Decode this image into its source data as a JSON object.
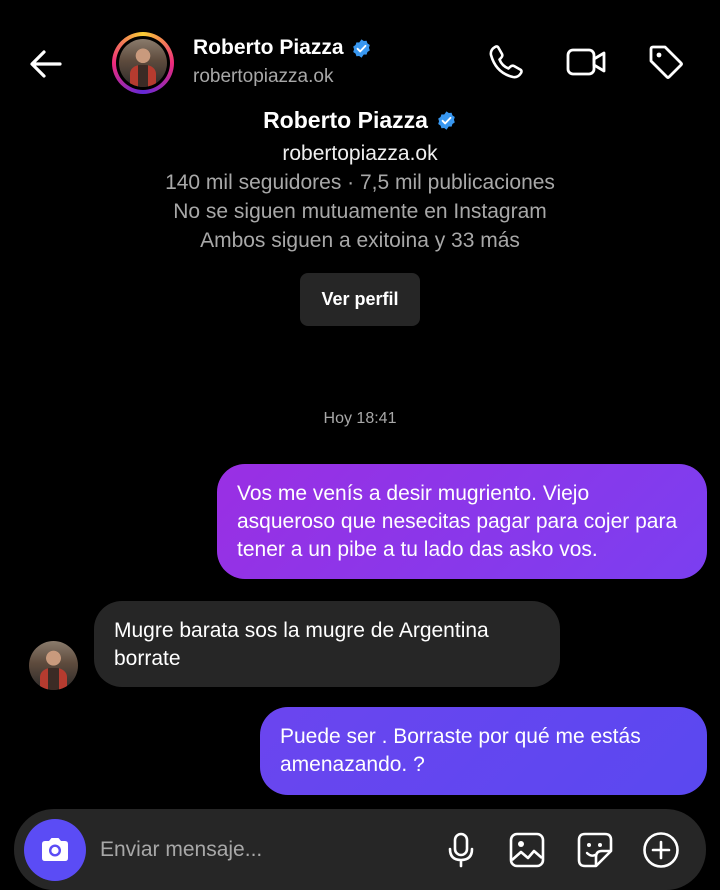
{
  "header": {
    "name": "Roberto Piazza",
    "handle": "robertopiazza.ok"
  },
  "profile": {
    "name": "Roberto Piazza",
    "handle": "robertopiazza.ok",
    "stats": "140 mil seguidores · 7,5 mil publicaciones",
    "mutual_follow": "No se siguen mutuamente en Instagram",
    "followed_by": "Ambos siguen a exitoina y 33 más",
    "view_profile_label": "Ver perfil"
  },
  "thread": {
    "timestamp": "Hoy 18:41",
    "messages": [
      {
        "from": "me",
        "text": "Vos me venís a desir mugriento.  Viejo asqueroso que nesecitas pagar para cojer para tener a un pibe a tu lado das asko vos."
      },
      {
        "from": "them",
        "text": "Mugre barata sos la mugre de Argentina borrate"
      },
      {
        "from": "me",
        "text": "Puede ser . Borraste por qué me estás amenazando. ?"
      }
    ]
  },
  "composer": {
    "placeholder": "Enviar mensaje..."
  },
  "colors": {
    "background": "#000000",
    "sent_bubble": "#8b36ea",
    "received_bubble": "#262626",
    "camera_button": "#5b4cf5",
    "verified_badge": "#3897f0"
  },
  "icons": [
    "back-arrow-icon",
    "verified-icon",
    "phone-icon",
    "video-icon",
    "tag-icon",
    "camera-icon",
    "microphone-icon",
    "gallery-icon",
    "sticker-icon",
    "plus-circle-icon"
  ]
}
